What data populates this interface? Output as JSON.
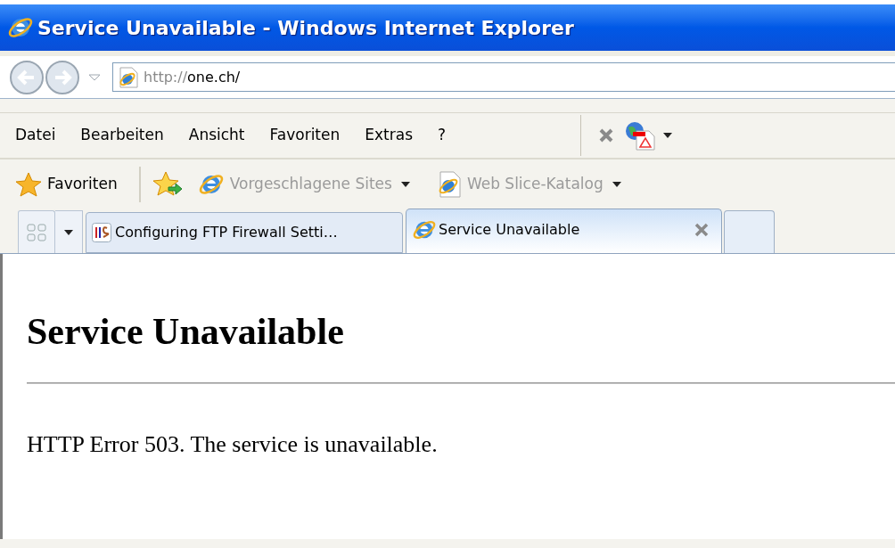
{
  "window": {
    "title": "Service Unavailable - Windows Internet Explorer"
  },
  "address": {
    "scheme": "http://",
    "host": "one.ch/"
  },
  "menu": [
    {
      "label": "Datei"
    },
    {
      "label": "Bearbeiten"
    },
    {
      "label": "Ansicht"
    },
    {
      "label": "Favoriten"
    },
    {
      "label": "Extras"
    },
    {
      "label": "?"
    }
  ],
  "favorites_bar": {
    "label": "Favoriten",
    "links": [
      {
        "label": "Vorgeschlagene Sites"
      },
      {
        "label": "Web Slice-Katalog"
      }
    ]
  },
  "tabs": [
    {
      "label": "Configuring FTP Firewall Setti…",
      "selected": false,
      "kind": "iis"
    },
    {
      "label": "Service Unavailable",
      "selected": true,
      "kind": "ie"
    }
  ],
  "page": {
    "heading": "Service Unavailable",
    "message": "HTTP Error 503. The service is unavailable."
  }
}
